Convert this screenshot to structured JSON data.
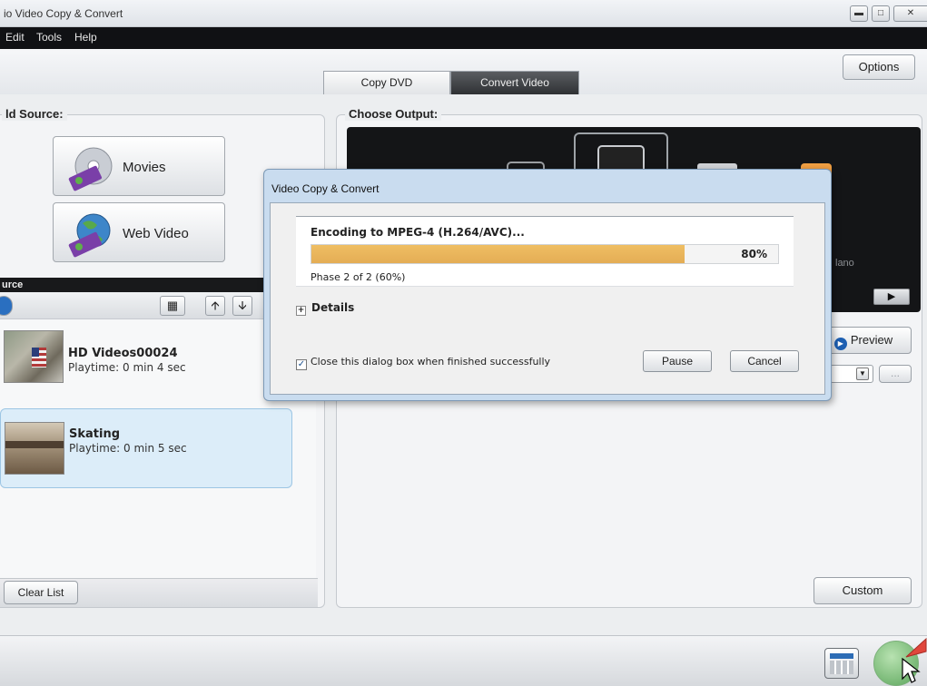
{
  "window": {
    "title": "io Video Copy & Convert"
  },
  "menu": {
    "items": [
      "Edit",
      "Tools",
      "Help"
    ]
  },
  "toolbar": {
    "options_label": "Options"
  },
  "tabs": [
    {
      "label": "Copy DVD",
      "active": false
    },
    {
      "label": "Convert Video",
      "active": true
    }
  ],
  "source_panel": {
    "title": "ld Source:",
    "buttons": [
      {
        "label": "Movies",
        "icon": "disc-film-icon"
      },
      {
        "label": "Web Video",
        "icon": "globe-film-icon"
      }
    ],
    "section_label": "urce",
    "list": [
      {
        "title": "HD Videos00024",
        "subtitle": "Playtime: 0 min 4 sec",
        "selected": false
      },
      {
        "title": "Skating",
        "subtitle": "Playtime: 0 min 5 sec",
        "selected": true
      }
    ],
    "clear_label": "Clear List"
  },
  "output_panel": {
    "title": "Choose Output:",
    "device_label": "lano",
    "preview_label": "Preview",
    "browse_label": "...",
    "custom_label": "Custom"
  },
  "dialog": {
    "title": "Video Copy & Convert",
    "encoding_label": "Encoding to MPEG-4 (H.264/AVC)...",
    "progress_fraction": 0.8,
    "progress_text": "80%",
    "phase_text": "Phase  2 of 2  (60%)",
    "details_label": "Details",
    "checkbox_label": "Close this dialog box when finished successfully",
    "checkbox_checked": true,
    "pause_label": "Pause",
    "cancel_label": "Cancel"
  },
  "colors": {
    "progress": "#efbe63",
    "selected_row": "#dcedf9",
    "menubar": "#101114",
    "dialog_frame": "#c9dcef"
  }
}
